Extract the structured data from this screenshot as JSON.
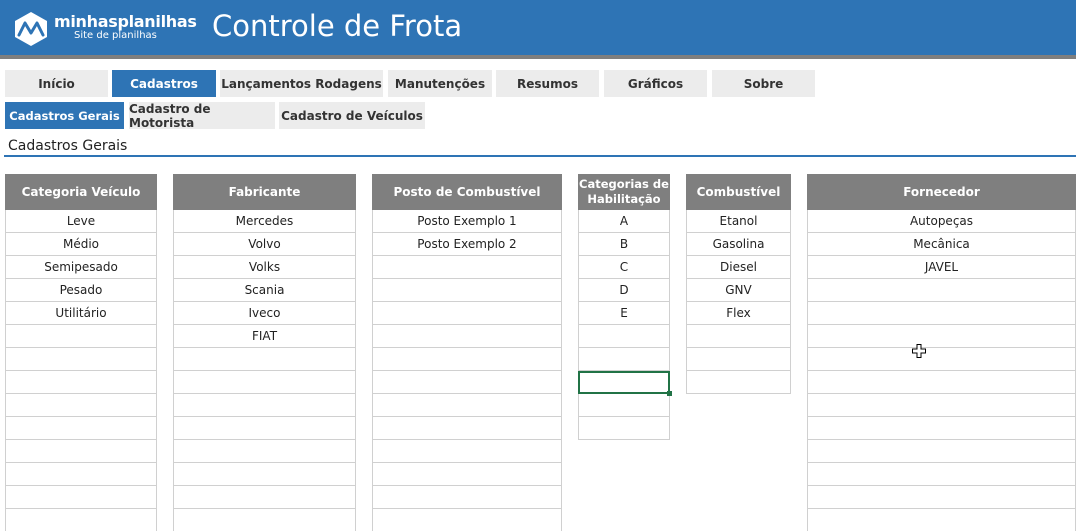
{
  "logo": {
    "name": "minhasplanilhas",
    "tagline": "Site de planilhas"
  },
  "app_title": "Controle de Frota",
  "main_tabs": [
    {
      "label": "Início",
      "active": false
    },
    {
      "label": "Cadastros",
      "active": true
    },
    {
      "label": "Lançamentos Rodagens",
      "active": false
    },
    {
      "label": "Manutenções",
      "active": false
    },
    {
      "label": "Resumos",
      "active": false
    },
    {
      "label": "Gráficos",
      "active": false
    },
    {
      "label": "Sobre",
      "active": false
    }
  ],
  "sub_tabs": [
    {
      "label": "Cadastros Gerais",
      "active": true
    },
    {
      "label": "Cadastro de Motorista",
      "active": false
    },
    {
      "label": "Cadastro de Veículos",
      "active": false
    }
  ],
  "section_title": "Cadastros Gerais",
  "columns": [
    {
      "header": "Categoria Veículo",
      "rows": [
        "Leve",
        "Médio",
        "Semipesado",
        "Pesado",
        "Utilitário",
        "",
        "",
        "",
        "",
        "",
        "",
        "",
        "",
        ""
      ]
    },
    {
      "header": "Fabricante",
      "rows": [
        "Mercedes",
        "Volvo",
        "Volks",
        "Scania",
        "Iveco",
        "FIAT",
        "",
        "",
        "",
        "",
        "",
        "",
        "",
        ""
      ]
    },
    {
      "header": "Posto de Combustível",
      "rows": [
        "Posto Exemplo 1",
        "Posto Exemplo 2",
        "",
        "",
        "",
        "",
        "",
        "",
        "",
        "",
        "",
        "",
        "",
        ""
      ]
    },
    {
      "header": "Categorias de Habilitação",
      "rows": [
        "A",
        "B",
        "C",
        "D",
        "E",
        "",
        "",
        "",
        "",
        ""
      ]
    },
    {
      "header": "Combustível",
      "rows": [
        "Etanol",
        "Gasolina",
        "Diesel",
        "GNV",
        "Flex",
        "",
        "",
        ""
      ]
    },
    {
      "header": "Fornecedor",
      "rows": [
        "Autopeças",
        "Mecânica",
        "JAVEL",
        "",
        "",
        "",
        "",
        "",
        "",
        "",
        "",
        "",
        "",
        ""
      ]
    }
  ],
  "colors": {
    "header_blue": "#2e74b5",
    "table_header_gray": "#7f7f7f",
    "selection_green": "#217346"
  }
}
